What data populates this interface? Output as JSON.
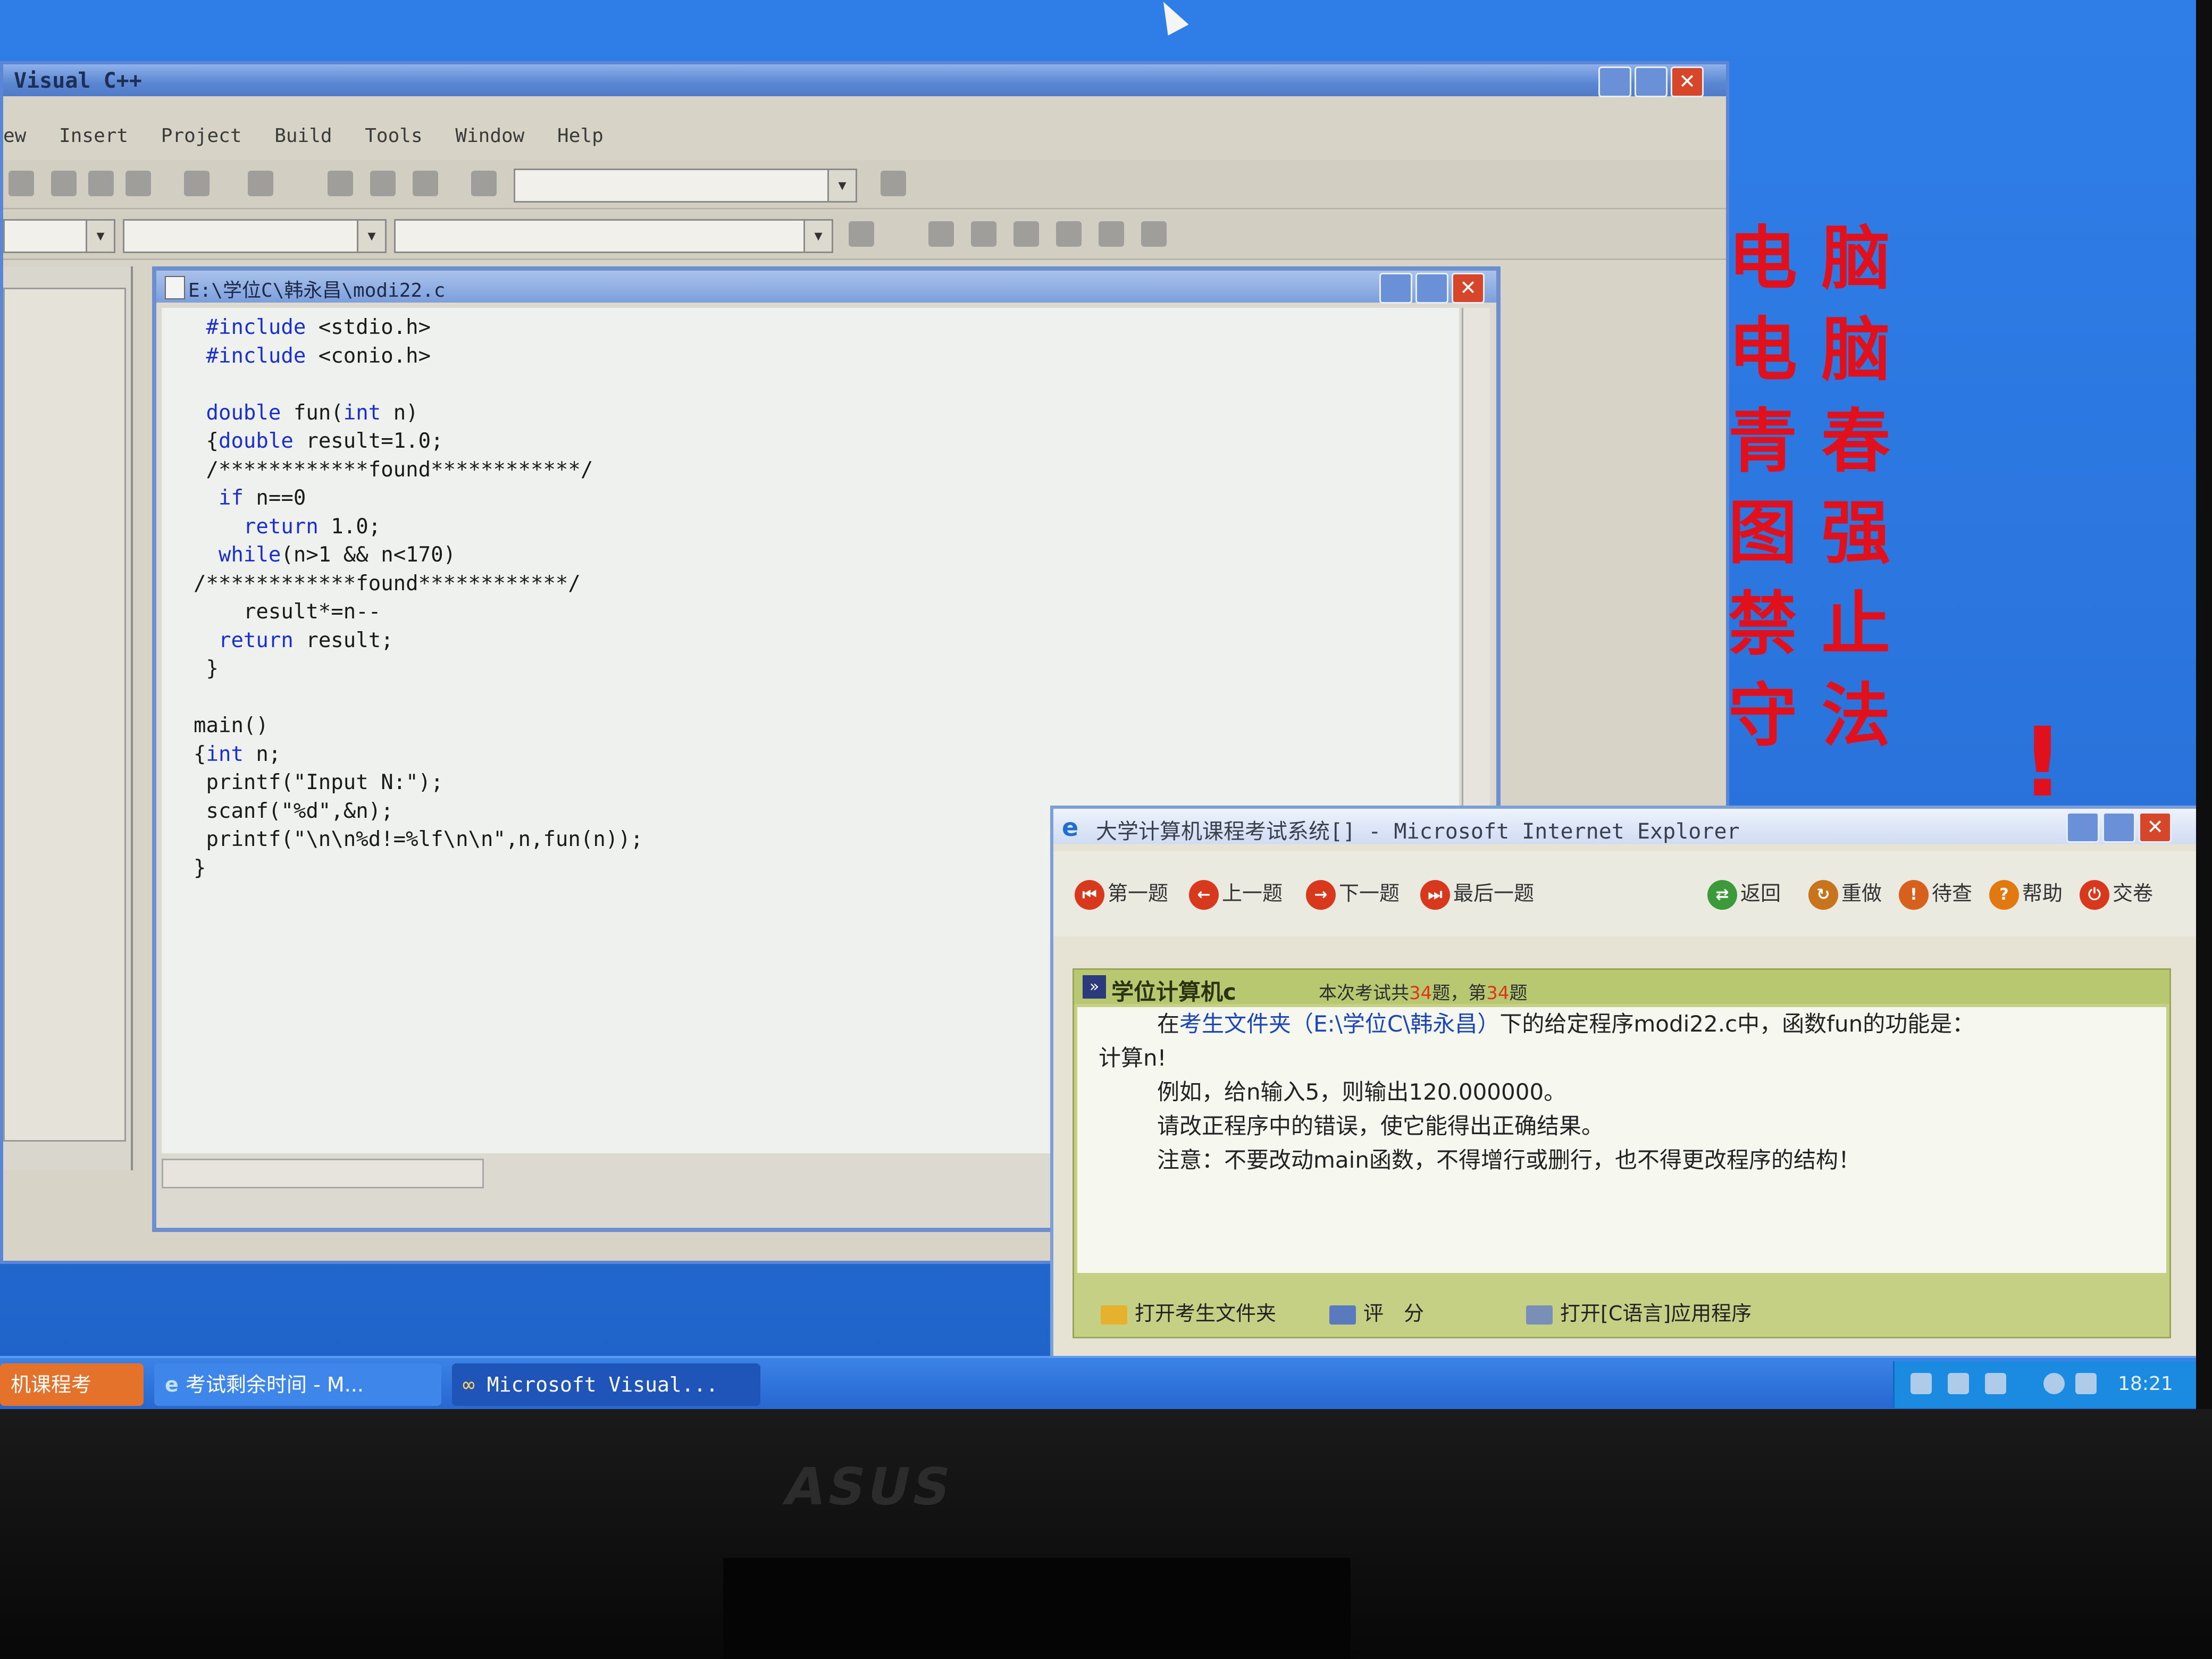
{
  "vc_window": {
    "title": "Visual C++",
    "menu": [
      "ew",
      "Insert",
      "Project",
      "Build",
      "Tools",
      "Window",
      "Help"
    ]
  },
  "editor": {
    "title": "E:\\学位C\\韩永昌\\modi22.c",
    "code_lines": [
      " #include <stdio.h>",
      " #include <conio.h>",
      "",
      " double fun(int n)",
      " {double result=1.0;",
      " /************found************/",
      "  if n==0",
      "    return 1.0;",
      "  while(n>1 && n<170)",
      "/************found************/",
      "    result*=n--",
      "  return result;",
      " }",
      "",
      "main()",
      "{int n;",
      " printf(\"Input N:\");",
      " scanf(\"%d\",&n);",
      " printf(\"\\n\\n%d!=%lf\\n\\n\",n,fun(n));",
      "}"
    ]
  },
  "wallpaper_notice": {
    "lines": [
      "电 脑",
      "电 脑",
      "青 春",
      "图 强",
      "禁 止",
      "守 法"
    ]
  },
  "ie_window": {
    "title": "大学计算机课程考试系统[] - Microsoft Internet Explorer",
    "nav": {
      "first": "第一题",
      "prev": "上一题",
      "next": "下一题",
      "last": "最后一题",
      "back": "返回",
      "redo": "重做",
      "pending": "待查",
      "help": "帮助",
      "submit": "交卷"
    },
    "content": {
      "section_title": "学位计算机c",
      "count_prefix": "本次考试共",
      "count_total": "34",
      "count_mid": "题，第",
      "count_current": "34",
      "count_suffix": "题",
      "line1_pre": "在",
      "line1_folder": "考生文件夹（E:\\学位C\\韩永昌）",
      "line1_post": "下的给定程序modi22.c中，函数fun的功能是：",
      "line2": "计算n!",
      "line3": "例如，给n输入5，则输出120.000000。",
      "line4": "请改正程序中的错误，使它能得出正确结果。",
      "line5": "注意：不要改动main函数，不得增行或删行，也不得更改程序的结构！"
    },
    "footer": {
      "open_folder": "打开考生文件夹",
      "grade": "评　分",
      "open_app": "打开[C语言]应用程序"
    }
  },
  "taskbar": {
    "task1": "机课程考",
    "task2": "考试剩余时间 - M...",
    "task3": "Microsoft Visual...",
    "clock": "18:21"
  },
  "monitor": {
    "brand": "ASUS"
  },
  "colors": {
    "desktop": "#2a73dc",
    "notice_red": "#e0101c",
    "keyword_blue": "#1a2fcf",
    "ie_panel_green": "#c6d084"
  }
}
